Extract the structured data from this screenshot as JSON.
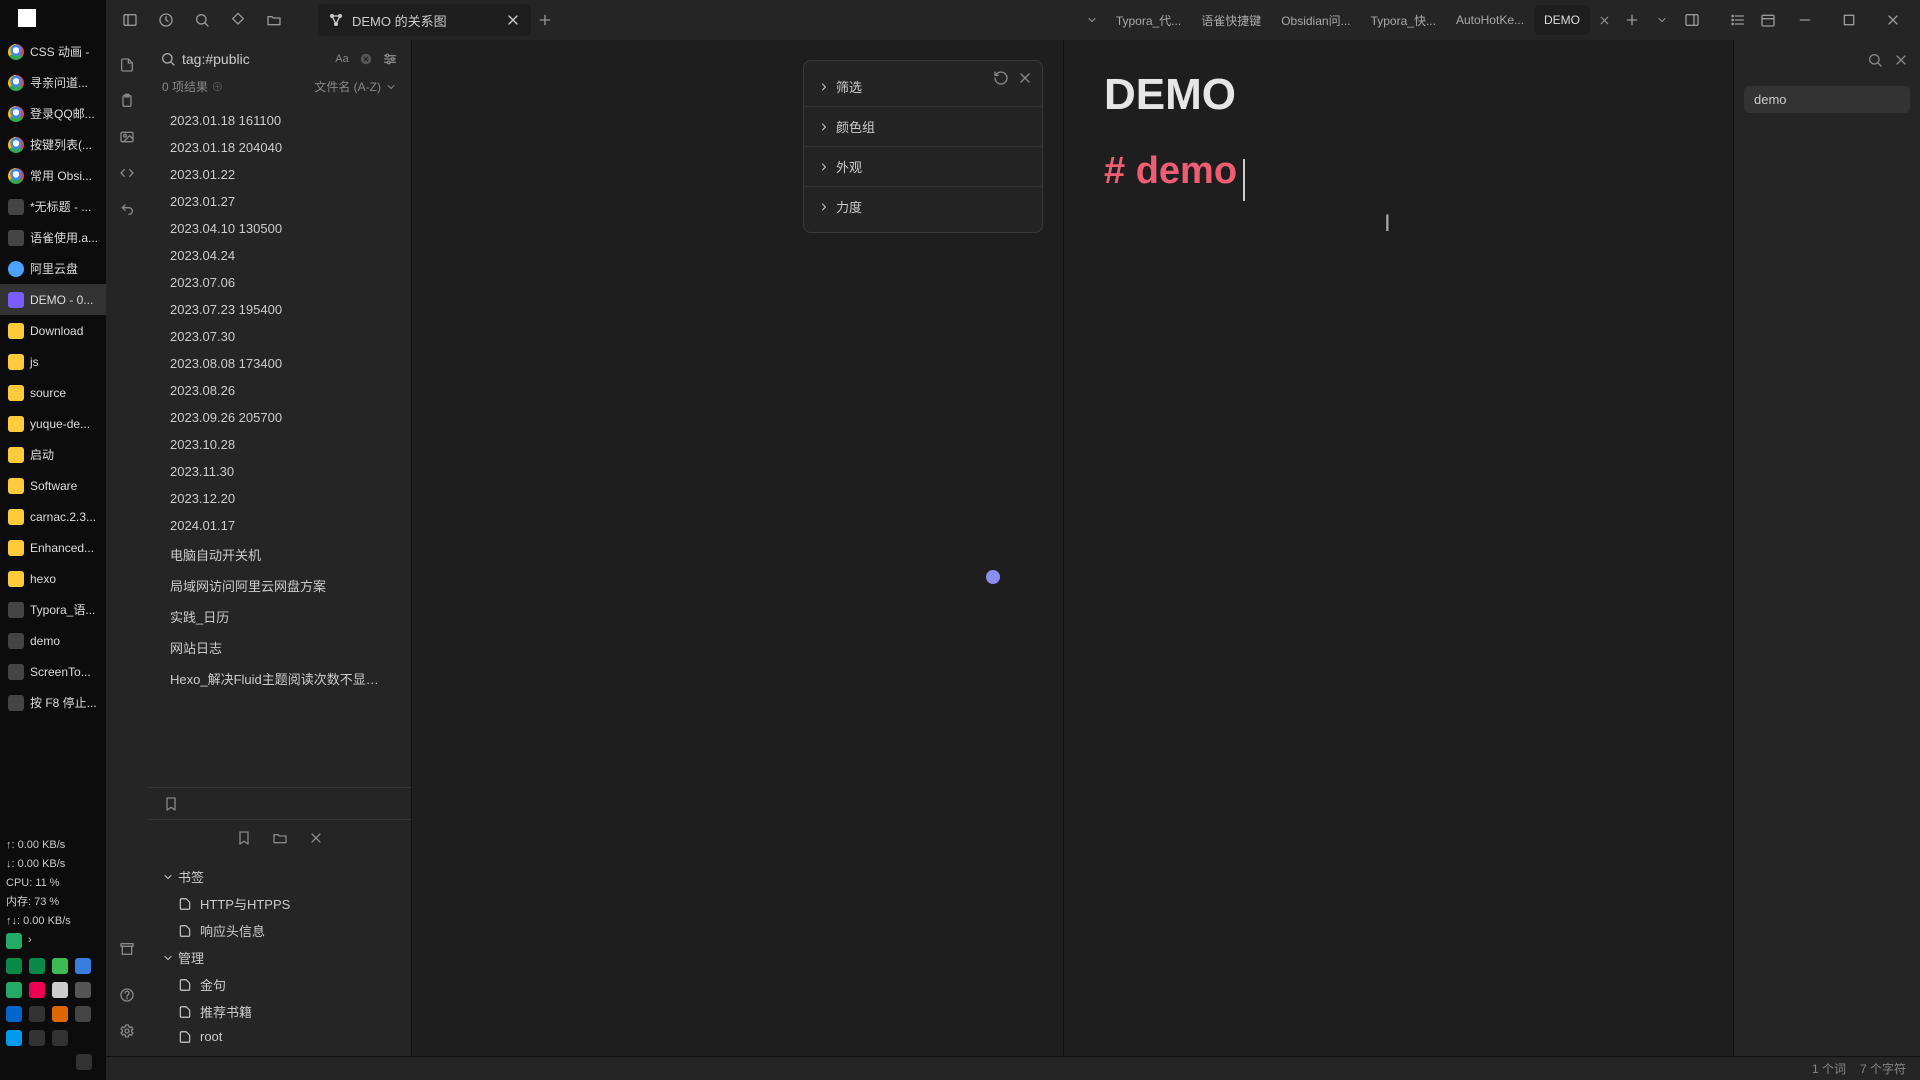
{
  "taskbar": {
    "items": [
      {
        "label": "CSS 动画 -",
        "ico": "chrome"
      },
      {
        "label": "寻亲问道...",
        "ico": "chrome"
      },
      {
        "label": "登录QQ邮...",
        "ico": "chrome"
      },
      {
        "label": "按键列表(...",
        "ico": "chrome"
      },
      {
        "label": "常用 Obsi...",
        "ico": "chrome"
      },
      {
        "label": "*无标题 - ...",
        "ico": "dark"
      },
      {
        "label": "语雀使用.a...",
        "ico": "dark"
      },
      {
        "label": "阿里云盘",
        "ico": "ali"
      },
      {
        "label": "DEMO - 0...",
        "ico": "obs",
        "active": true
      },
      {
        "label": "Download",
        "ico": "folder"
      },
      {
        "label": "js",
        "ico": "folder"
      },
      {
        "label": "source",
        "ico": "folder"
      },
      {
        "label": "yuque-de...",
        "ico": "folder"
      },
      {
        "label": "启动",
        "ico": "folder"
      },
      {
        "label": "Software",
        "ico": "folder"
      },
      {
        "label": "carnac.2.3...",
        "ico": "folder"
      },
      {
        "label": "Enhanced...",
        "ico": "folder"
      },
      {
        "label": "hexo",
        "ico": "folder"
      },
      {
        "label": "Typora_语...",
        "ico": "dark"
      },
      {
        "label": "demo",
        "ico": "dark"
      },
      {
        "label": "ScreenTo...",
        "ico": "dark"
      },
      {
        "label": "按 F8 停止...",
        "ico": "dark"
      }
    ],
    "stats": {
      "up": "↑: 0.00 KB/s",
      "down": "↓: 0.00 KB/s",
      "cpu": "CPU: 11 %",
      "mem": "内存: 73 %",
      "net": "↑↓: 0.00 KB/s"
    }
  },
  "titlebar": {
    "graph_tab": "DEMO 的关系图",
    "docs": [
      "Typora_代...",
      "语雀快捷键",
      "Obsidian问...",
      "Typora_快...",
      "AutoHotKe...",
      "DEMO"
    ]
  },
  "search": {
    "query": "tag:#public",
    "result_count": "0 项结果",
    "sort_label": "文件名 (A-Z)"
  },
  "files": [
    "2023.01.18 161100",
    "2023.01.18 204040",
    "2023.01.22",
    "2023.01.27",
    "2023.04.10 130500",
    "2023.04.24",
    "2023.07.06",
    "2023.07.23 195400",
    "2023.07.30",
    "2023.08.08 173400",
    "2023.08.26",
    "2023.09.26 205700",
    "2023.10.28",
    "2023.11.30",
    "2023.12.20",
    "2024.01.17",
    "电脑自动开关机",
    "局域网访问阿里云网盘方案",
    "实践_日历",
    "网站日志",
    "Hexo_解决Fluid主题阅读次数不显示问题"
  ],
  "bookmarks": {
    "groups": [
      {
        "name": "书签",
        "items": [
          "HTTP与HTPPS",
          "响应头信息"
        ]
      },
      {
        "name": "管理",
        "items": [
          "金句",
          "推荐书籍",
          "root"
        ]
      }
    ]
  },
  "graph_panel": {
    "rows": [
      "筛选",
      "颜色组",
      "外观",
      "力度"
    ]
  },
  "editor": {
    "title": "DEMO",
    "tag": "# demo"
  },
  "outline": {
    "item": "demo"
  },
  "status": {
    "words": "1 个词",
    "chars": "7 个字符"
  }
}
